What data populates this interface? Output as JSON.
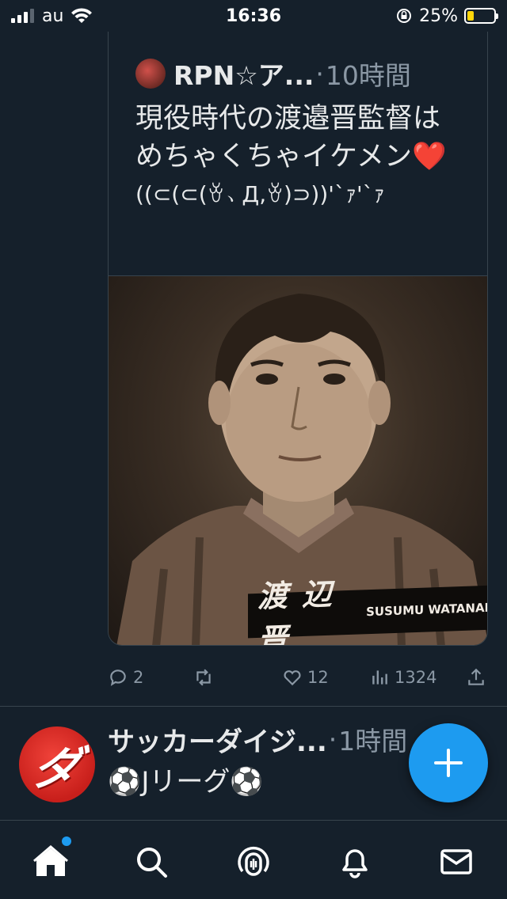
{
  "status_bar": {
    "carrier": "au",
    "time": "16:36",
    "battery_percent": "25%",
    "battery_level": 0.25,
    "icons": [
      "signal-icon",
      "wifi-icon",
      "rotation-lock-icon",
      "battery-icon"
    ]
  },
  "quoted_tweet": {
    "author": "RPN☆ア...",
    "separator": "·",
    "time": "10時間",
    "text": "現役時代の渡邉晋監督はめちゃくちゃイケメン❤️",
    "kaomoji": "((⊂(⊂(ꈊ、Д,ꈊ)⊃))'`ｧ'`ｧ",
    "photo": {
      "name_jp": "渡辺 晋",
      "name_en": "SUSUMU WATANAB"
    }
  },
  "actions": {
    "replies": "2",
    "retweets": "",
    "likes": "12",
    "views": "1324"
  },
  "tweet2": {
    "author": "サッカーダイジ...",
    "separator": "·",
    "time": "1時間",
    "text": "⚽️Jリーグ⚽️",
    "avatar_logo": "ダ"
  },
  "fab": {
    "icon": "plus-icon"
  },
  "tab_bar": {
    "tabs": [
      "home-icon",
      "search-icon",
      "spaces-icon",
      "notifications-icon",
      "messages-icon"
    ],
    "active": "home-icon"
  },
  "colors": {
    "background": "#15202b",
    "accent": "#1d9bf0",
    "secondary_text": "#8b98a5",
    "border": "#38444d",
    "battery_fill": "#ffd60a"
  }
}
